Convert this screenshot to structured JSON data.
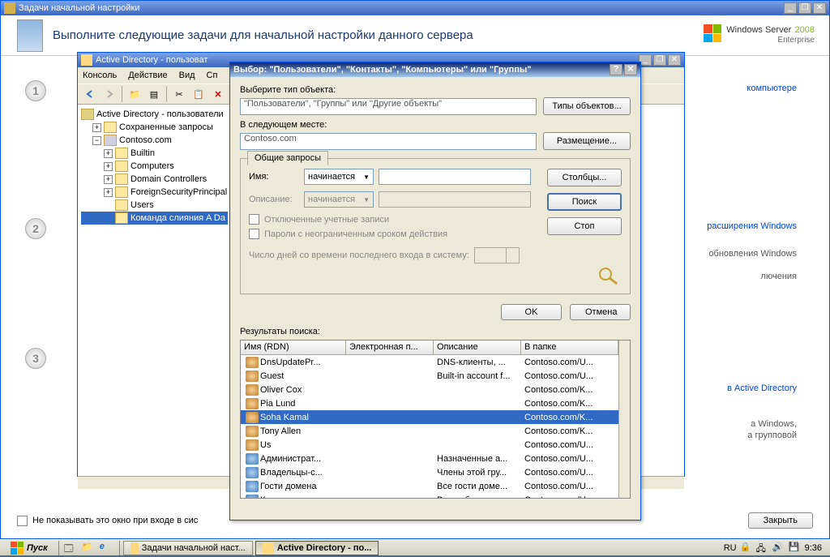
{
  "bg_window": {
    "title": "Задачи начальной настройки",
    "header": "Выполните следующие задачи для начальной настройки данного сервера",
    "ws_brand": "Windows Server",
    "ws_year": "2008",
    "ws_edition": "Enterprise",
    "link1": "компьютере",
    "link2": "расширения Windows",
    "text1": "обновления Windows",
    "text2": "лючения",
    "link3": "в Active Directory",
    "text3": "а Windows,",
    "text4": "а групповой",
    "checkbox_label": "Не показывать это окно при входе в сис",
    "close_btn": "Закрыть"
  },
  "ad_window": {
    "title": "Active Directory - пользоват",
    "menus": [
      "Консоль",
      "Действие",
      "Вид",
      "Сп"
    ],
    "tree": {
      "root": "Active Directory - пользователи",
      "saved": "Сохраненные запросы",
      "domain": "Contoso.com",
      "items": [
        "Builtin",
        "Computers",
        "Domain Controllers",
        "ForeignSecurityPrincipal",
        "Users",
        "Команда слияния A Da"
      ]
    }
  },
  "sel_dialog": {
    "title": "Выбор: \"Пользователи\", \"Контакты\", \"Компьютеры\" или \"Группы\"",
    "obj_type_label": "Выберите тип объекта:",
    "obj_type_value": "\"Пользователи\", \"Группы\" или \"Другие объекты\"",
    "obj_type_btn": "Типы объектов...",
    "location_label": "В следующем месте:",
    "location_value": "Contoso.com",
    "location_btn": "Размещение...",
    "group_tab": "Общие запросы",
    "name_label": "Имя:",
    "name_mode": "начинается",
    "desc_label": "Описание:",
    "desc_mode": "начинается",
    "chk1": "Отключенные учетные записи",
    "chk2": "Пароли с неограниченным сроком действия",
    "days_label": "Число дней со времени последнего входа в систему:",
    "btn_columns": "Столбцы...",
    "btn_search": "Поиск",
    "btn_stop": "Стоп",
    "btn_ok": "OK",
    "btn_cancel": "Отмена",
    "results_label": "Результаты поиска:",
    "cols": [
      "Имя (RDN)",
      "Электронная п...",
      "Описание",
      "В папке"
    ],
    "rows": [
      {
        "name": "DnsUpdatePr...",
        "email": "",
        "desc": "DNS-клиенты, ...",
        "folder": "Contoso.com/U...",
        "type": "user"
      },
      {
        "name": "Guest",
        "email": "",
        "desc": "Built-in account f...",
        "folder": "Contoso.com/U...",
        "type": "user"
      },
      {
        "name": "Oliver Cox",
        "email": "",
        "desc": "",
        "folder": "Contoso.com/K...",
        "type": "user"
      },
      {
        "name": "Pia Lund",
        "email": "",
        "desc": "",
        "folder": "Contoso.com/K...",
        "type": "user"
      },
      {
        "name": "Soha Kamal",
        "email": "",
        "desc": "",
        "folder": "Contoso.com/K...",
        "type": "user",
        "selected": true
      },
      {
        "name": "Tony Allen",
        "email": "",
        "desc": "",
        "folder": "Contoso.com/K...",
        "type": "user"
      },
      {
        "name": "Us",
        "email": "",
        "desc": "",
        "folder": "Contoso.com/U...",
        "type": "user"
      },
      {
        "name": "Администрат...",
        "email": "",
        "desc": "Назначенные а...",
        "folder": "Contoso.com/U...",
        "type": "group"
      },
      {
        "name": "Владельцы-с...",
        "email": "",
        "desc": "Члены этой гру...",
        "folder": "Contoso.com/U...",
        "type": "group"
      },
      {
        "name": "Гости домена",
        "email": "",
        "desc": "Все гости доме...",
        "folder": "Contoso.com/U...",
        "type": "group"
      },
      {
        "name": "Компьютеры...",
        "email": "",
        "desc": "Все рабочие ст...",
        "folder": "Contoso.com/U...",
        "type": "group"
      }
    ]
  },
  "taskbar": {
    "start": "Пуск",
    "tasks": [
      {
        "label": "Задачи начальной наст...",
        "active": false
      },
      {
        "label": "Active Directory - по...",
        "active": true
      }
    ],
    "lang": "RU",
    "time": "9:36"
  }
}
